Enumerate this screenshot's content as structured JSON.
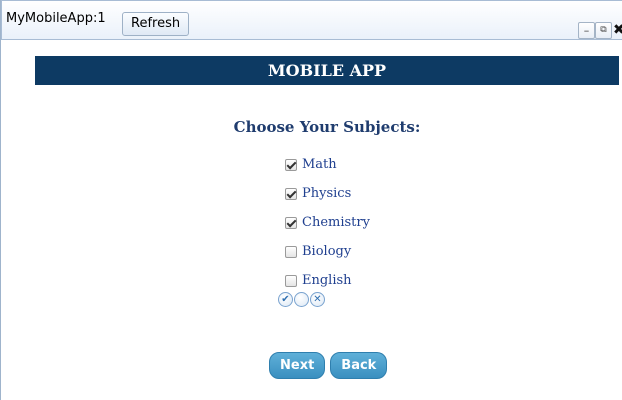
{
  "window": {
    "title": "MyMobileApp:1",
    "refresh_label": "Refresh",
    "minimize_glyph": "–",
    "popout_glyph": "⧉",
    "close_glyph": "✖"
  },
  "header": {
    "title": "MOBILE APP",
    "background_color": "#0d3a63"
  },
  "subjects": {
    "title": "Choose Your Subjects:",
    "items": [
      {
        "label": "Math",
        "checked": true
      },
      {
        "label": "Physics",
        "checked": true
      },
      {
        "label": "Chemistry",
        "checked": true
      },
      {
        "label": "Biology",
        "checked": false
      },
      {
        "label": "English",
        "checked": false
      }
    ]
  },
  "tri_state": {
    "check_glyph": "✔",
    "empty_glyph": "",
    "clear_glyph": "✕"
  },
  "buttons": {
    "next_label": "Next",
    "back_label": "Back",
    "accent_color": "#3a8fc0"
  }
}
